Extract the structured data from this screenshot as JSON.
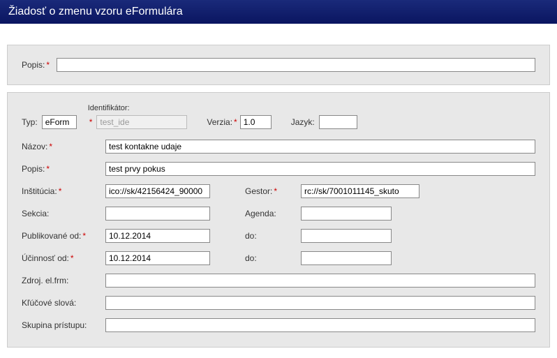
{
  "header": {
    "title": "Žiadosť o zmenu vzoru eFormulára"
  },
  "top": {
    "popis_label": "Popis:",
    "popis_value": ""
  },
  "form": {
    "typ_label": "Typ:",
    "typ_value": "eForm",
    "identifikator_label": "Identifikátor:",
    "identifikator_placeholder": "test_ide",
    "verzia_label": "Verzia:",
    "verzia_value": "1.0",
    "jazyk_label": "Jazyk:",
    "jazyk_value": "",
    "nazov_label": "Názov:",
    "nazov_value": "test kontakne udaje",
    "popis_label": "Popis:",
    "popis_value": "test prvy pokus",
    "institucia_label": "Inštitúcia:",
    "institucia_value": "ico://sk/42156424_90000",
    "gestor_label": "Gestor:",
    "gestor_value": "rc://sk/7001011145_skuto",
    "sekcia_label": "Sekcia:",
    "sekcia_value": "",
    "agenda_label": "Agenda:",
    "agenda_value": "",
    "publikovane_od_label": "Publikované od:",
    "publikovane_od_value": "10.12.2014",
    "publikovane_do_label": "do:",
    "publikovane_do_value": "",
    "ucinnost_od_label": "Účinnosť od:",
    "ucinnost_od_value": "10.12.2014",
    "ucinnost_do_label": "do:",
    "ucinnost_do_value": "",
    "zdroj_label": "Zdroj. el.frm:",
    "zdroj_value": "",
    "klucove_label": "Kľúčové slová:",
    "klucove_value": "",
    "skupina_label": "Skupina prístupu:",
    "skupina_value": ""
  }
}
